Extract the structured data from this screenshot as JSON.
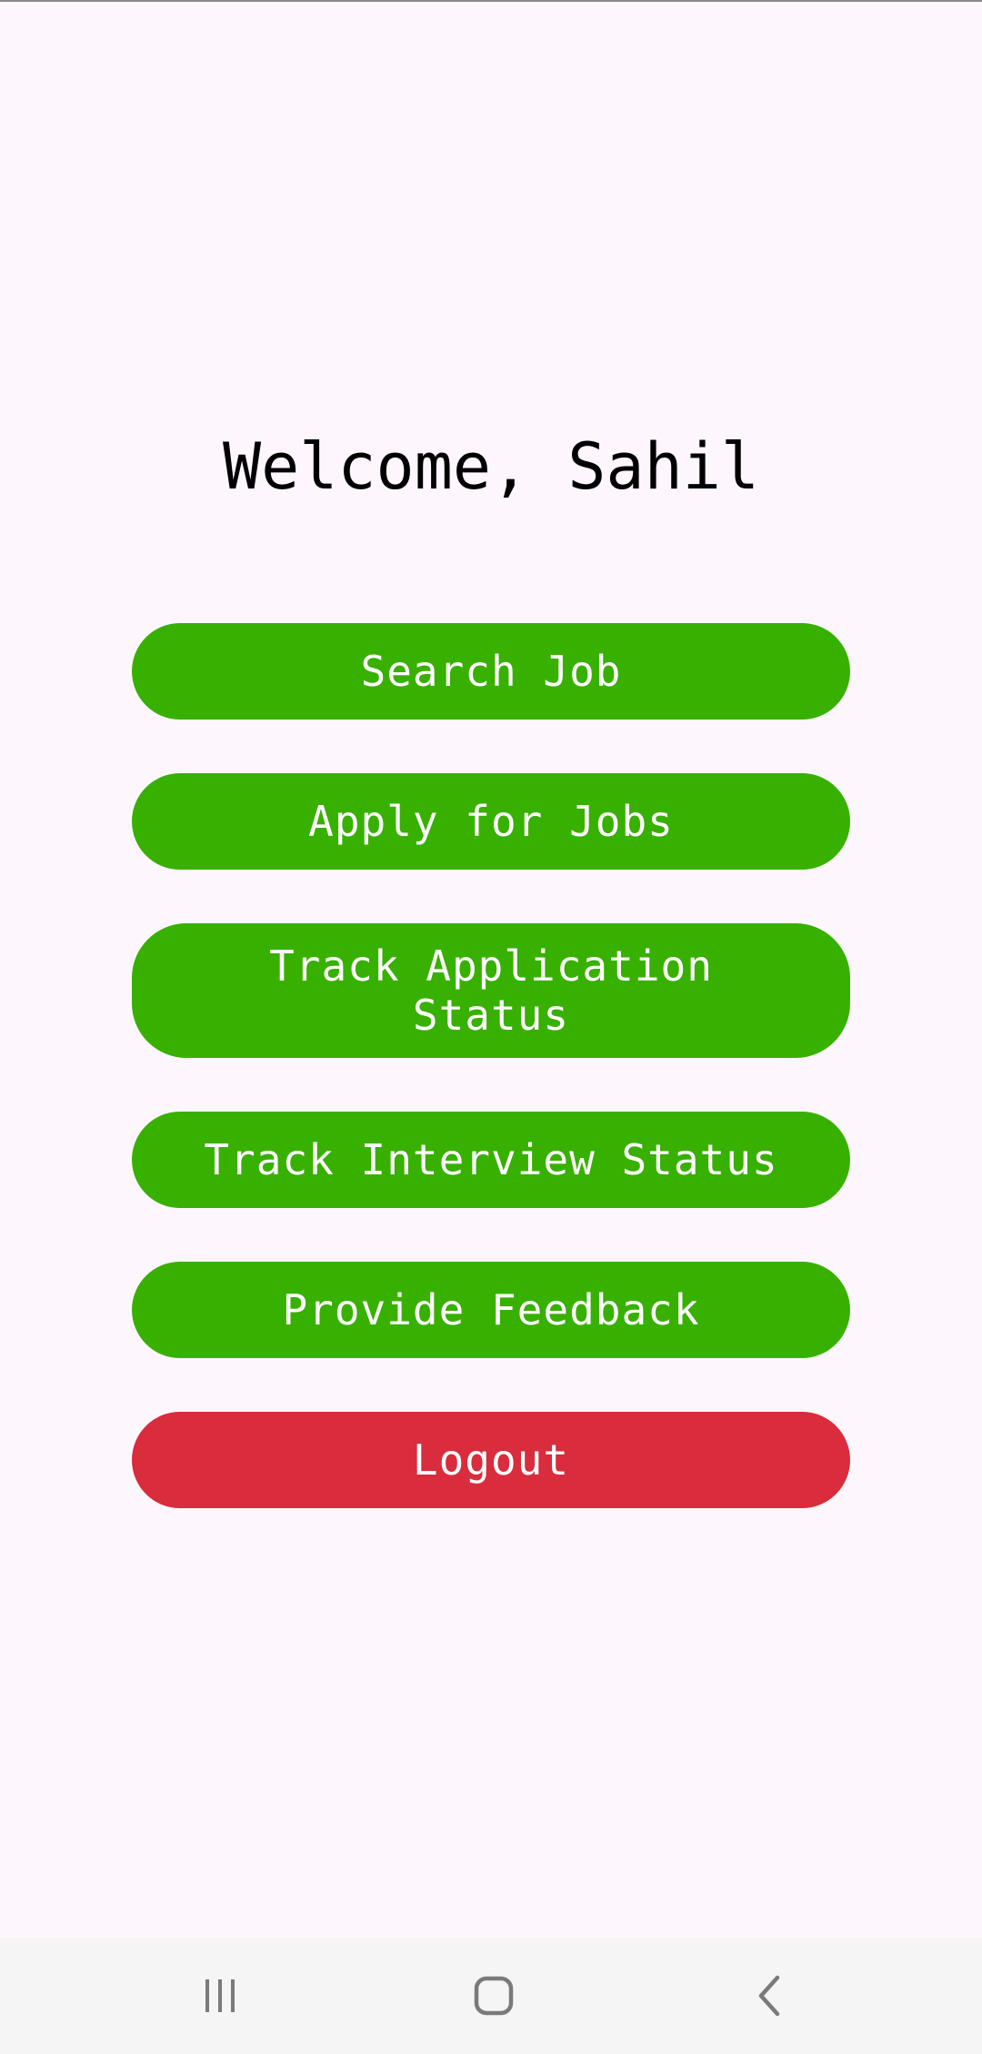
{
  "screen": {
    "background": "#fdf7fd",
    "welcome_text": "Welcome, Sahil"
  },
  "menu": {
    "buttons": [
      {
        "label": "Search Job",
        "color": "#38b000"
      },
      {
        "label": "Apply for Jobs",
        "color": "#38b000"
      },
      {
        "label": "Track Application Status",
        "color": "#38b000"
      },
      {
        "label": "Track Interview Status",
        "color": "#38b000"
      },
      {
        "label": "Provide Feedback",
        "color": "#38b000"
      },
      {
        "label": "Logout",
        "color": "#d92c3c"
      }
    ]
  },
  "system_nav": {
    "icons": [
      "recent-apps-icon",
      "home-icon",
      "back-icon"
    ]
  }
}
